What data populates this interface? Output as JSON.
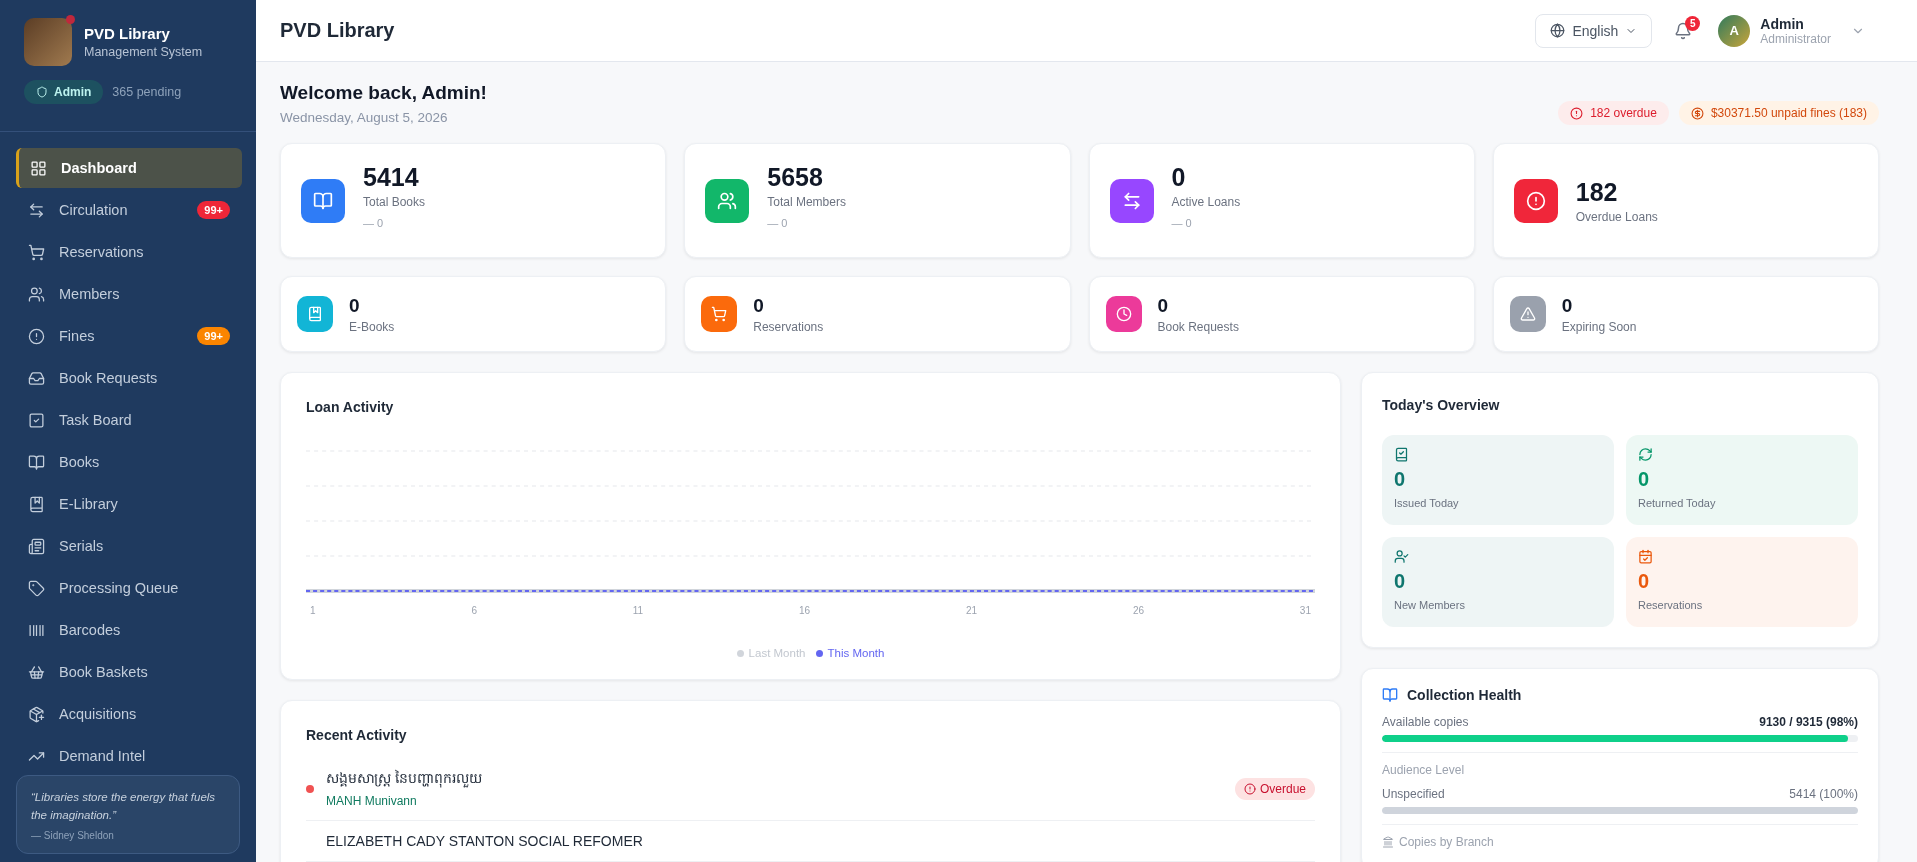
{
  "sidebar": {
    "brand": {
      "title": "PVD Library",
      "subtitle": "Management System",
      "online": true
    },
    "role_badge": "Admin",
    "pending": "365 pending",
    "items": [
      {
        "label": "Dashboard",
        "selected": true
      },
      {
        "label": "Circulation",
        "selected": false,
        "badge": "99+",
        "color": "#ef2638"
      },
      {
        "label": "Reservations",
        "selected": false
      },
      {
        "label": "Members",
        "selected": false
      },
      {
        "label": "Fines",
        "selected": false,
        "badge": "99+",
        "color": "#fb8500"
      },
      {
        "label": "Book Requests",
        "selected": false
      },
      {
        "label": "Task Board",
        "selected": false
      },
      {
        "label": "Books",
        "selected": false
      },
      {
        "label": "E-Library",
        "selected": false
      },
      {
        "label": "Serials",
        "selected": false
      },
      {
        "label": "Processing Queue",
        "selected": false
      },
      {
        "label": "Barcodes",
        "selected": false
      },
      {
        "label": "Book Baskets",
        "selected": false
      },
      {
        "label": "Acquisitions",
        "selected": false
      },
      {
        "label": "Demand Intel",
        "selected": false
      }
    ],
    "quote": {
      "text": "“Libraries store the energy that fuels the imagination.”",
      "author": "— Sidney Sheldon"
    }
  },
  "header": {
    "title": "PVD Library",
    "language": "English",
    "notifications": "5",
    "user": {
      "initial": "A",
      "name": "Admin",
      "role": "Administrator"
    }
  },
  "welcome": {
    "title": "Welcome back, Admin!",
    "date": "Wednesday, August 5, 2026",
    "alerts": [
      {
        "kind": "overdue",
        "text": "182 overdue"
      },
      {
        "kind": "fines",
        "text": "$30371.50 unpaid fines (183)"
      }
    ]
  },
  "stats": [
    {
      "value": "5414",
      "label": "Total Books",
      "trend": "— 0",
      "color": "#2f7cf6"
    },
    {
      "value": "5658",
      "label": "Total Members",
      "trend": "— 0",
      "color": "#12b76a"
    },
    {
      "value": "0",
      "label": "Active Loans",
      "trend": "— 0",
      "color": "#9747ff"
    },
    {
      "value": "182",
      "label": "Overdue Loans",
      "color": "#f0263a"
    }
  ],
  "mini_stats": [
    {
      "value": "0",
      "label": "E-Books",
      "color": "#12b5d6"
    },
    {
      "value": "0",
      "label": "Reservations",
      "color": "#fb6a0c"
    },
    {
      "value": "0",
      "label": "Book Requests",
      "color": "#ec3a9a"
    },
    {
      "value": "0",
      "label": "Expiring Soon",
      "color": "#9aa1ad"
    }
  ],
  "loan_activity": {
    "title": "Loan Activity",
    "x_labels": [
      "1",
      "6",
      "11",
      "16",
      "21",
      "26",
      "31"
    ],
    "legend": [
      {
        "label": "Last Month",
        "color": "#d1d5db"
      },
      {
        "label": "This Month",
        "color": "#6366f1"
      }
    ]
  },
  "recent_activity": {
    "title": "Recent Activity",
    "items": [
      {
        "title": "សង្គមសាស្ត្រ នៃបញ្ហាពុករលួយ",
        "member": "MANH Munivann",
        "status": "Overdue",
        "color": "#f05252"
      },
      {
        "title": "ELIZABETH CADY STANTON SOCIAL REFOMER"
      }
    ]
  },
  "today": {
    "title": "Today's Overview",
    "tiles": [
      {
        "value": "0",
        "label": "Issued Today",
        "color": "#0f766e"
      },
      {
        "value": "0",
        "label": "Returned Today",
        "color": "#059669"
      },
      {
        "value": "0",
        "label": "New Members",
        "color": "#0f766e"
      },
      {
        "value": "0",
        "label": "Reservations",
        "color": "#ea580c"
      }
    ]
  },
  "collection_health": {
    "title": "Collection Health",
    "available": {
      "label": "Available copies",
      "reading": "9130 / 9315 (98%)",
      "level": 0.98
    },
    "audience": {
      "title": "Audience Level",
      "label": "Unspecified",
      "reading": "5414 (100%)",
      "level": 1
    },
    "branch_title": "Copies by Branch"
  }
}
